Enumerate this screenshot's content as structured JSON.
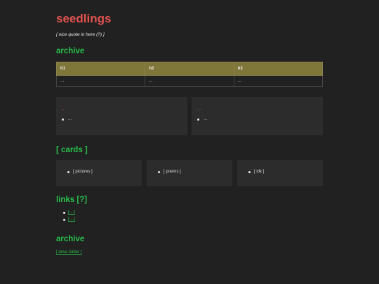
{
  "site": {
    "title": "seedlings",
    "quote": "[ nice quote in here (?) ]"
  },
  "archive": {
    "heading": "archive",
    "columns": [
      "h1",
      "h2",
      "h3"
    ],
    "rows": [
      [
        "...",
        "...",
        "..."
      ]
    ]
  },
  "panels": [
    {
      "title": "...",
      "items": [
        "..."
      ]
    },
    {
      "title": "...",
      "items": [
        "..."
      ]
    }
  ],
  "cards": {
    "heading": "[ cards ]",
    "items": [
      "[ pictures ]",
      "[ poems ]",
      "[ idk ]"
    ]
  },
  "links": {
    "heading": "links [?]",
    "items": [
      "[....]",
      "[....]"
    ]
  },
  "archive2": {
    "heading": "archive",
    "link": "[ drive folder ]"
  },
  "colors": {
    "background": "#212121",
    "title_red": "#e0524f",
    "heading_green": "#27c04b",
    "table_header": "#7f7639",
    "panel": "#2c2c2c"
  }
}
